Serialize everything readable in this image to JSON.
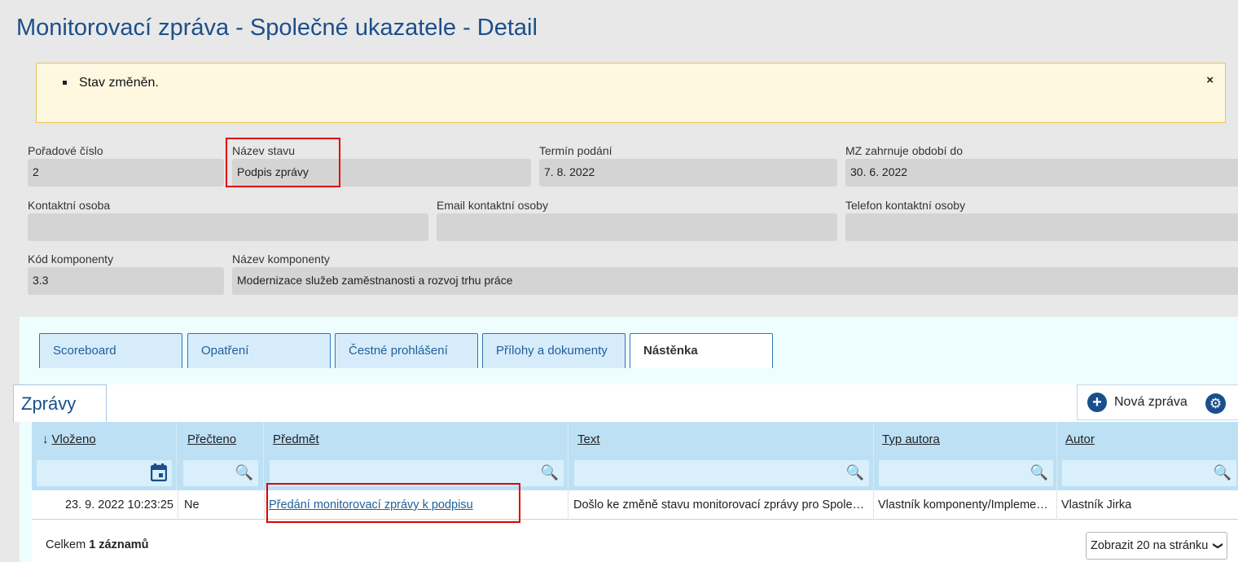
{
  "page": {
    "title": "Monitorovací zpráva - Společné ukazatele - Detail"
  },
  "alert": {
    "message": "Stav změněn.",
    "close_label": "×"
  },
  "fields": {
    "poradove_cislo": {
      "label": "Pořadové číslo",
      "value": "2"
    },
    "nazev_stavu": {
      "label": "Název stavu",
      "value": "Podpis zprávy"
    },
    "termin_podani": {
      "label": "Termín podání",
      "value": "7. 8. 2022"
    },
    "mz_obdobi": {
      "label": "MZ zahrnuje období do",
      "value": "30. 6. 2022"
    },
    "kontaktni_osoba": {
      "label": "Kontaktní osoba",
      "value": ""
    },
    "email": {
      "label": "Email kontaktní osoby",
      "value": ""
    },
    "telefon": {
      "label": "Telefon kontaktní osoby",
      "value": ""
    },
    "kod_komponenty": {
      "label": "Kód komponenty",
      "value": "3.3"
    },
    "nazev_komponenty": {
      "label": "Název komponenty",
      "value": "Modernizace služeb zaměstnanosti a rozvoj trhu práce"
    }
  },
  "tabs": [
    {
      "label": "Scoreboard",
      "active": false
    },
    {
      "label": "Opatření",
      "active": false
    },
    {
      "label": "Čestné prohlášení",
      "active": false
    },
    {
      "label": "Přílohy a dokumenty",
      "active": false
    },
    {
      "label": "Nástěnka",
      "active": true
    }
  ],
  "messages": {
    "section_title": "Zprávy",
    "new_button": "Nová zpráva",
    "columns": [
      {
        "label": "Vloženo",
        "sorted": "desc",
        "filter_icon": "calendar-icon"
      },
      {
        "label": "Přečteno",
        "filter_icon": "search-icon"
      },
      {
        "label": "Předmět",
        "filter_icon": "search-icon"
      },
      {
        "label": "Text",
        "filter_icon": "search-icon"
      },
      {
        "label": "Typ autora",
        "filter_icon": "search-icon"
      },
      {
        "label": "Autor",
        "filter_icon": "search-icon"
      }
    ],
    "rows": [
      {
        "vlozeno": "23. 9. 2022 10:23:25",
        "precteno": "Ne",
        "predmet": "Předání monitorovací zprávy k podpisu",
        "text": "Došlo ke změně stavu monitorovací zprávy pro Společné ukazatele",
        "typ_autora": "Vlastník komponenty/Implementátor",
        "autor": "Vlastník Jirka"
      }
    ],
    "footer": {
      "prefix": "Celkem",
      "count": "1 záznamů",
      "page_size": "Zobrazit 20 na stránku"
    }
  },
  "colors": {
    "title": "#1b4f8c",
    "highlight": "#e00000",
    "header_bg": "#bde0f5",
    "link": "#1f5f99"
  }
}
